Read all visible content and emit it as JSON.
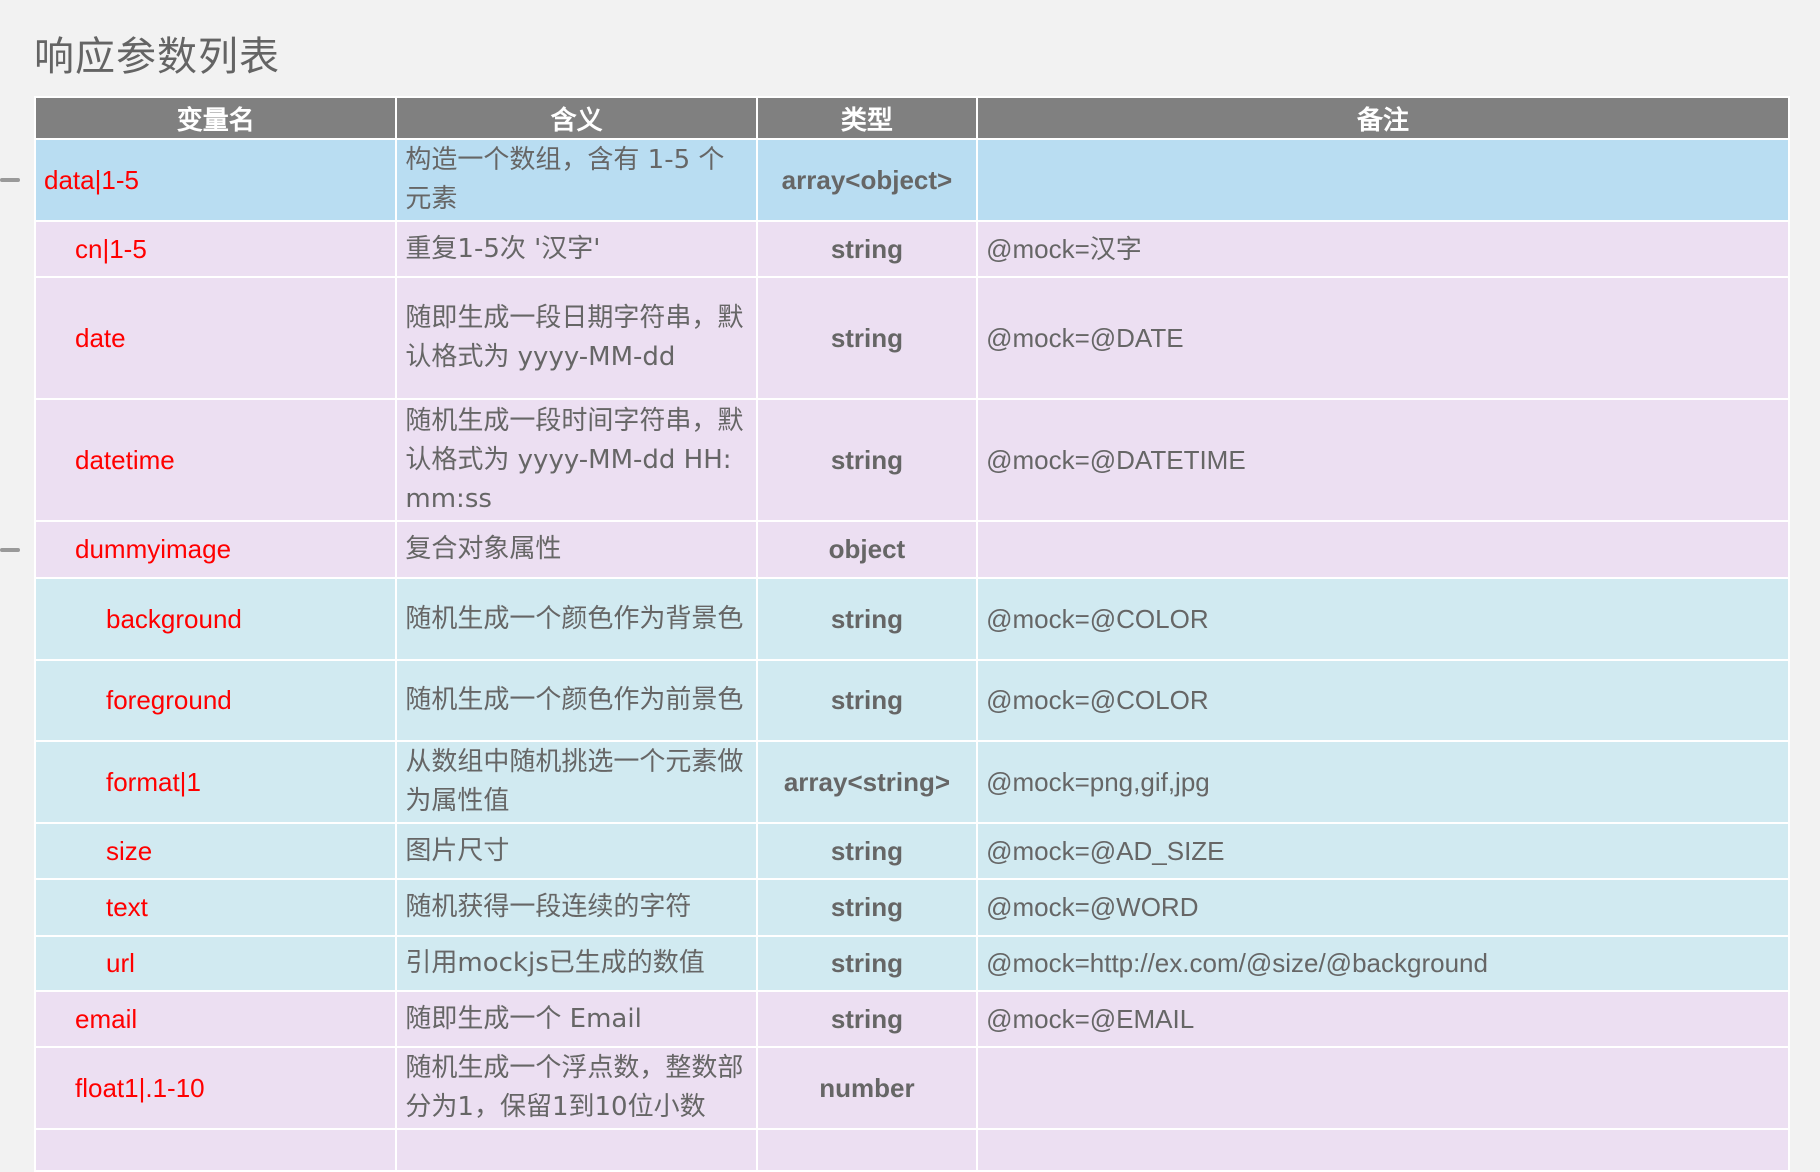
{
  "page": {
    "title": "响应参数列表"
  },
  "table": {
    "headers": {
      "name": "变量名",
      "meaning": "含义",
      "type": "类型",
      "note": "备注"
    },
    "rows": [
      {
        "name": "data|1-5",
        "level": 0,
        "color": "blue",
        "collapsible": true,
        "meaning": "构造一个数组，含有 1-5 个元素",
        "type": "array<object>",
        "note": ""
      },
      {
        "name": "cn|1-5",
        "level": 1,
        "color": "lavender",
        "collapsible": false,
        "meaning": "重复1-5次 '汉字'",
        "type": "string",
        "note": "@mock=汉字"
      },
      {
        "name": "date",
        "level": 1,
        "color": "lavender",
        "collapsible": false,
        "meaning": "随即生成一段日期字符串，默认格式为 yyyy-MM-dd",
        "type": "string",
        "note": "@mock=@DATE"
      },
      {
        "name": "datetime",
        "level": 1,
        "color": "lavender",
        "collapsible": false,
        "meaning": "随机生成一段时间字符串，默认格式为 yyyy-MM-dd HH:mm:ss",
        "type": "string",
        "note": "@mock=@DATETIME"
      },
      {
        "name": "dummyimage",
        "level": 1,
        "color": "lavender",
        "collapsible": true,
        "meaning": "复合对象属性",
        "type": "object",
        "note": ""
      },
      {
        "name": "background",
        "level": 2,
        "color": "teal",
        "collapsible": false,
        "meaning": "随机生成一个颜色作为背景色",
        "type": "string",
        "note": "@mock=@COLOR"
      },
      {
        "name": "foreground",
        "level": 2,
        "color": "teal",
        "collapsible": false,
        "meaning": "随机生成一个颜色作为前景色",
        "type": "string",
        "note": "@mock=@COLOR"
      },
      {
        "name": "format|1",
        "level": 2,
        "color": "teal",
        "collapsible": false,
        "meaning": "从数组中随机挑选一个元素做为属性值",
        "type": "array<string>",
        "note": "@mock=png,gif,jpg"
      },
      {
        "name": "size",
        "level": 2,
        "color": "teal",
        "collapsible": false,
        "meaning": "图片尺寸",
        "type": "string",
        "note": "@mock=@AD_SIZE"
      },
      {
        "name": "text",
        "level": 2,
        "color": "teal",
        "collapsible": false,
        "meaning": "随机获得一段连续的字符",
        "type": "string",
        "note": "@mock=@WORD"
      },
      {
        "name": "url",
        "level": 2,
        "color": "teal",
        "collapsible": false,
        "meaning": "引用mockjs已生成的数值",
        "type": "string",
        "note": "@mock=http://ex.com/@size/@background"
      },
      {
        "name": "email",
        "level": 1,
        "color": "lavender",
        "collapsible": false,
        "meaning": "随即生成一个 Email",
        "type": "string",
        "note": "@mock=@EMAIL"
      },
      {
        "name": "float1|.1-10",
        "level": 1,
        "color": "lavender",
        "collapsible": false,
        "meaning": "随机生成一个浮点数，整数部分为1，保留1到10位小数",
        "type": "number",
        "note": ""
      },
      {
        "name": "",
        "level": 1,
        "color": "lavender",
        "collapsible": false,
        "meaning": "",
        "type": "",
        "note": ""
      }
    ]
  }
}
